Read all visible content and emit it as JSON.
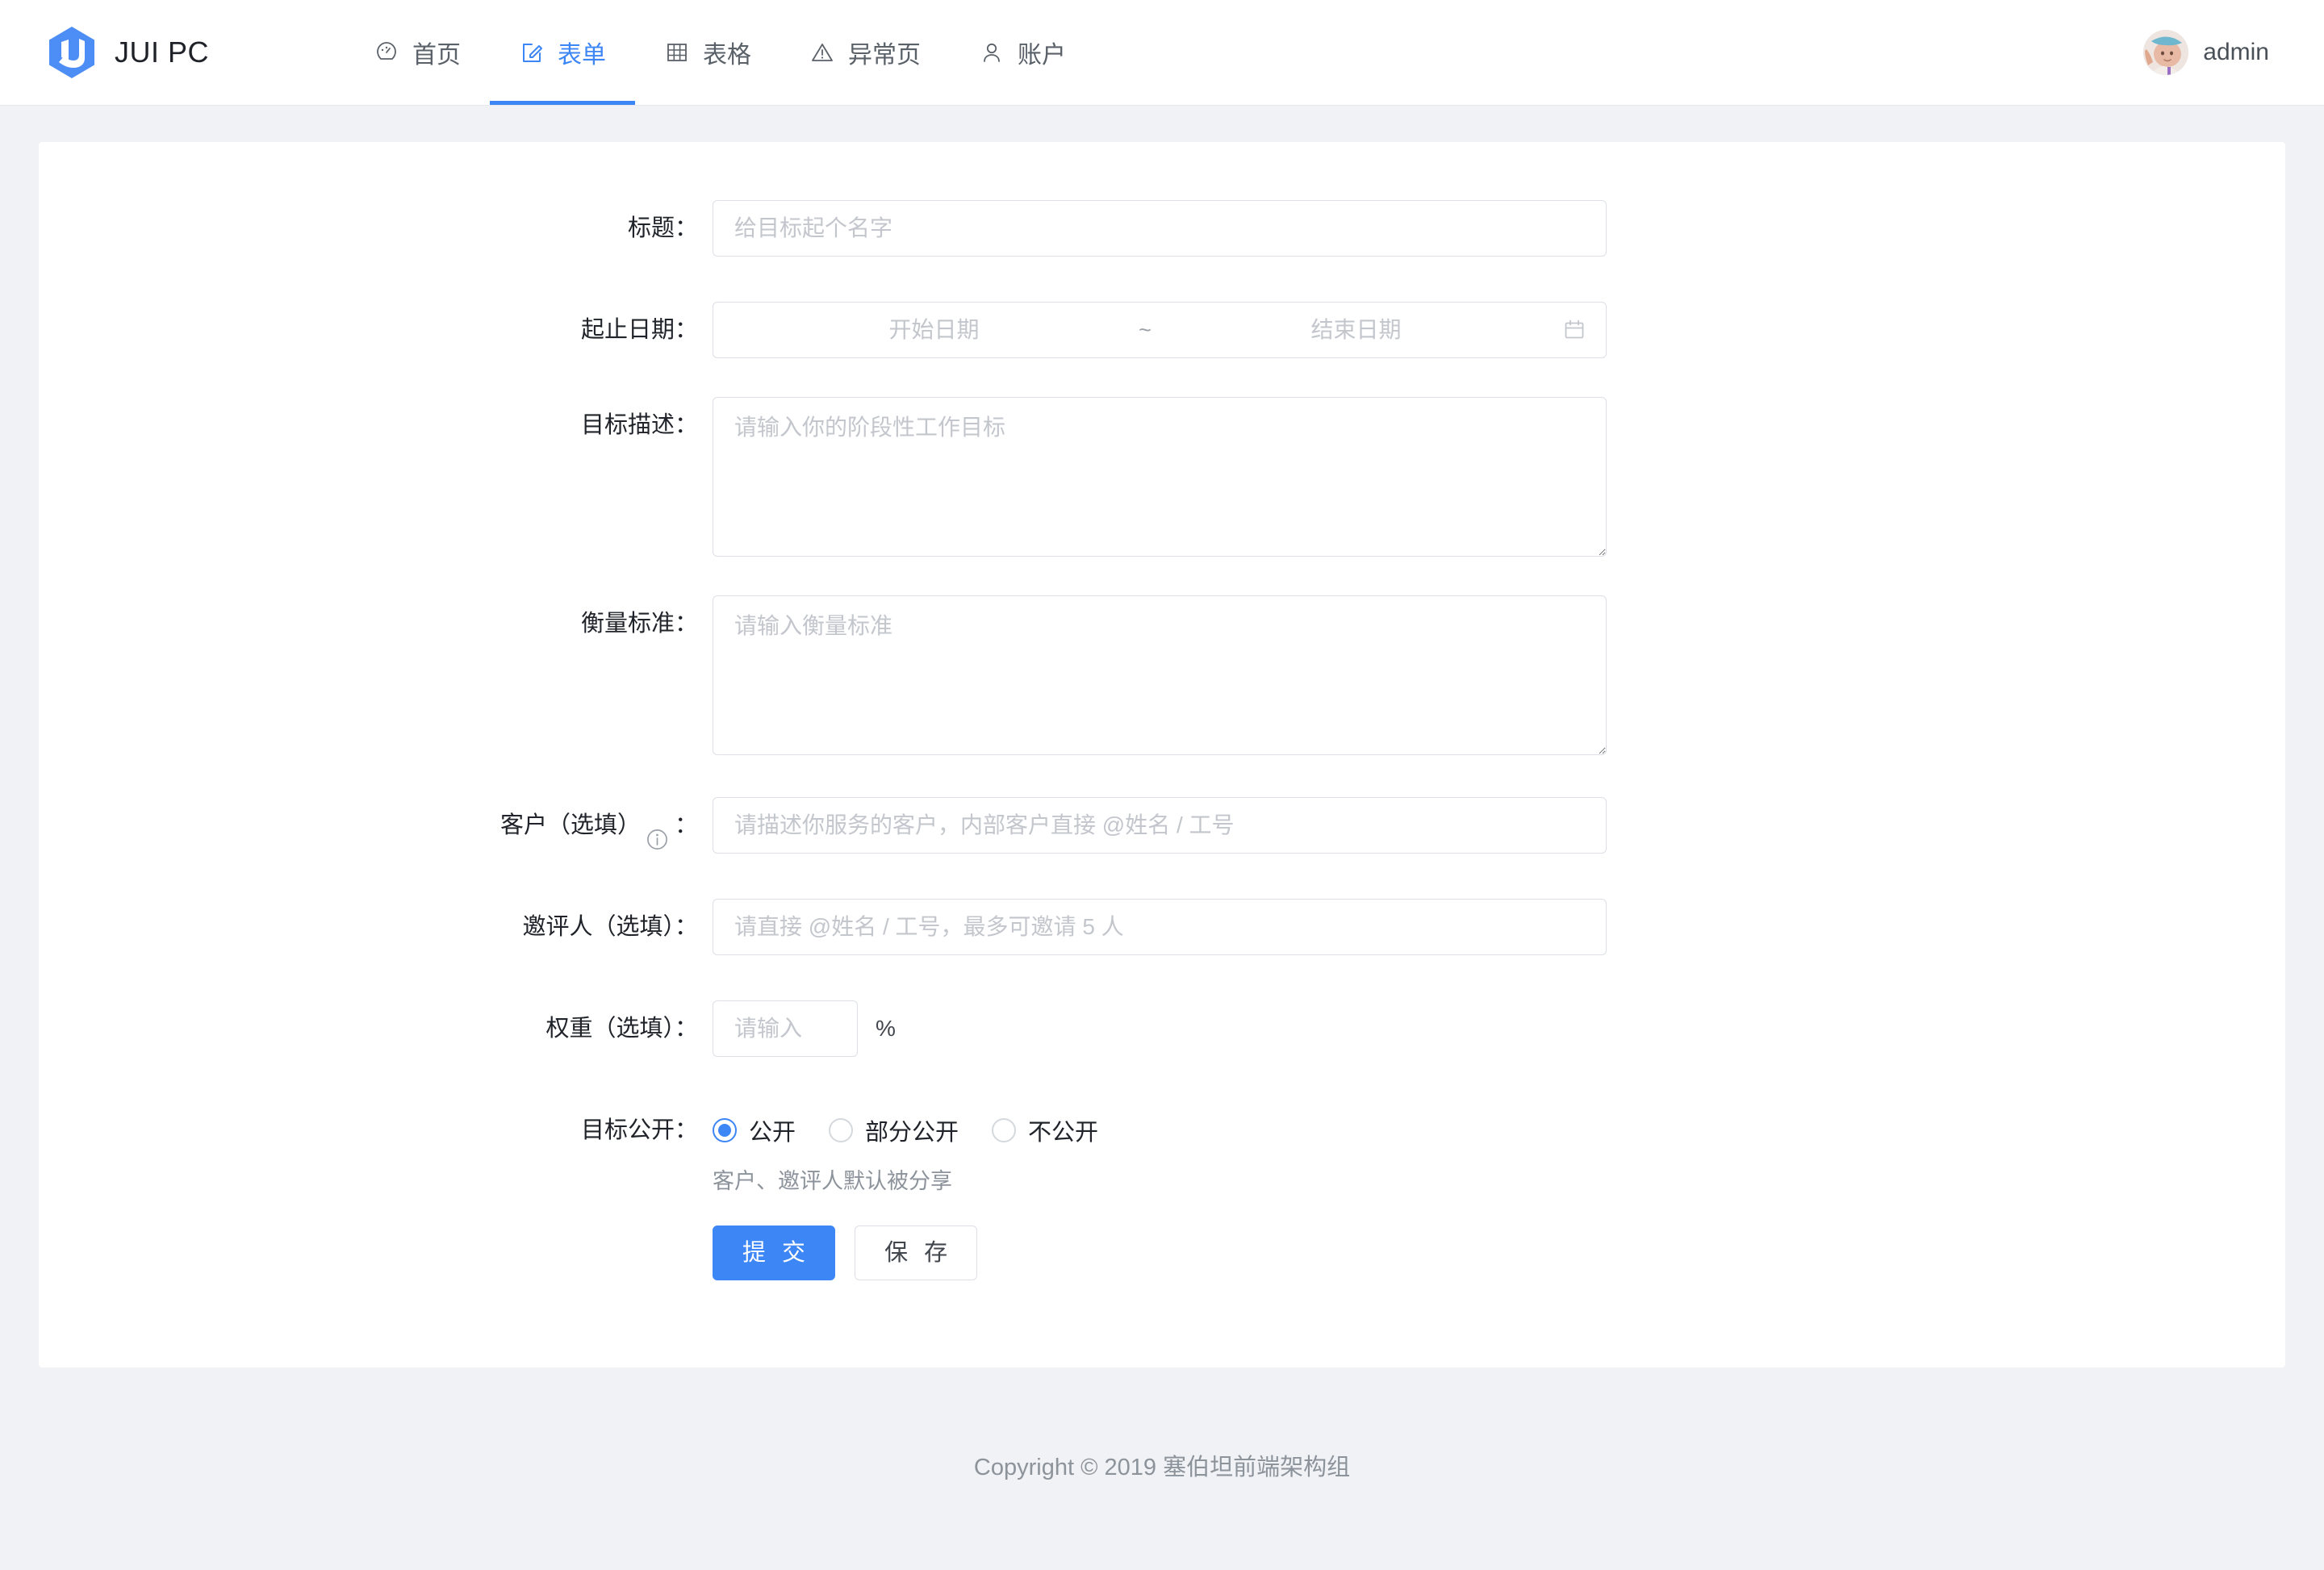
{
  "header": {
    "brand": {
      "logo_icon": "jui-hexagon-logo",
      "title": "JUI PC"
    },
    "nav": [
      {
        "icon": "dashboard-icon",
        "label": "首页",
        "active": false
      },
      {
        "icon": "form-edit-icon",
        "label": "表单",
        "active": true
      },
      {
        "icon": "table-grid-icon",
        "label": "表格",
        "active": false
      },
      {
        "icon": "warning-triangle-icon",
        "label": "异常页",
        "active": false
      },
      {
        "icon": "user-person-icon",
        "label": "账户",
        "active": false
      }
    ],
    "user": {
      "avatar_icon": "user-avatar-photo",
      "name": "admin"
    }
  },
  "form": {
    "title": {
      "label": "标题：",
      "placeholder": "给目标起个名字",
      "value": ""
    },
    "date_range": {
      "label": "起止日期：",
      "start_placeholder": "开始日期",
      "separator": "~",
      "end_placeholder": "结束日期",
      "start_value": "",
      "end_value": "",
      "icon": "calendar-icon"
    },
    "description": {
      "label": "目标描述：",
      "placeholder": "请输入你的阶段性工作目标",
      "value": ""
    },
    "measure": {
      "label": "衡量标准：",
      "placeholder": "请输入衡量标准",
      "value": ""
    },
    "client": {
      "label_prefix": "客户（选填）",
      "label_suffix": "：",
      "info_icon": "info-circle-icon",
      "placeholder": "请描述你服务的客户，内部客户直接 @姓名 / 工号",
      "value": ""
    },
    "invitee": {
      "label": "邀评人（选填）：",
      "placeholder": "请直接 @姓名 / 工号，最多可邀请 5 人",
      "value": ""
    },
    "weight": {
      "label": "权重（选填）：",
      "placeholder": "请输入",
      "value": "",
      "unit": "%"
    },
    "visibility": {
      "label": "目标公开：",
      "options": [
        {
          "label": "公开",
          "checked": true
        },
        {
          "label": "部分公开",
          "checked": false
        },
        {
          "label": "不公开",
          "checked": false
        }
      ],
      "hint": "客户、邀评人默认被分享"
    },
    "actions": {
      "submit": "提 交",
      "save": "保 存"
    }
  },
  "footer": {
    "copyright": "Copyright © 2019 塞伯坦前端架构组"
  },
  "colors": {
    "accent": "#3d86f5",
    "page_bg": "#f0f2f5",
    "card_bg": "#ffffff",
    "border": "#dcdfe6",
    "text": "#20242a",
    "muted": "#8d939b",
    "placeholder": "#c3c6cc"
  }
}
